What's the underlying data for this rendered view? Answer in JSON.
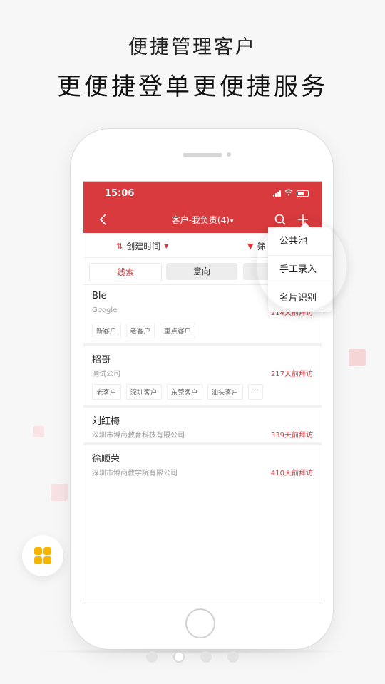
{
  "promo": {
    "subtitle": "便捷管理客户",
    "headline": "更便捷登单更便捷服务"
  },
  "status_bar": {
    "time": "15:06"
  },
  "nav": {
    "title": "客户-我负责(4)",
    "caret": "▾",
    "back_icon": "chevron-left-icon",
    "search_icon": "search-icon",
    "add_icon": "plus-icon"
  },
  "filter": {
    "sort_label": "创建时间",
    "filter_label": "筛"
  },
  "tabs": [
    {
      "label": "线索"
    },
    {
      "label": "意向"
    }
  ],
  "customers": [
    {
      "name": "Ble",
      "company": "Google",
      "visit": "214天前拜访",
      "tags": [
        "新客户",
        "老客户",
        "重点客户"
      ]
    },
    {
      "name": "招哥",
      "company": "测试公司",
      "visit": "217天前拜访",
      "tags": [
        "老客户",
        "深圳客户",
        "东莞客户",
        "汕头客户",
        "···"
      ]
    },
    {
      "name": "刘红梅",
      "company": "深圳市博商教育科技有限公司",
      "visit": "339天前拜访",
      "tags": []
    },
    {
      "name": "徐顺荣",
      "company": "深圳市博商教学院有限公司",
      "visit": "410天前拜访",
      "tags": []
    }
  ],
  "popup_menu": {
    "items": [
      "公共池",
      "手工录入",
      "名片识别"
    ]
  },
  "colors": {
    "brand_red": "#d83a3e",
    "accent_yellow": "#f7b500"
  },
  "pager": {
    "count": 4,
    "active": 1
  }
}
